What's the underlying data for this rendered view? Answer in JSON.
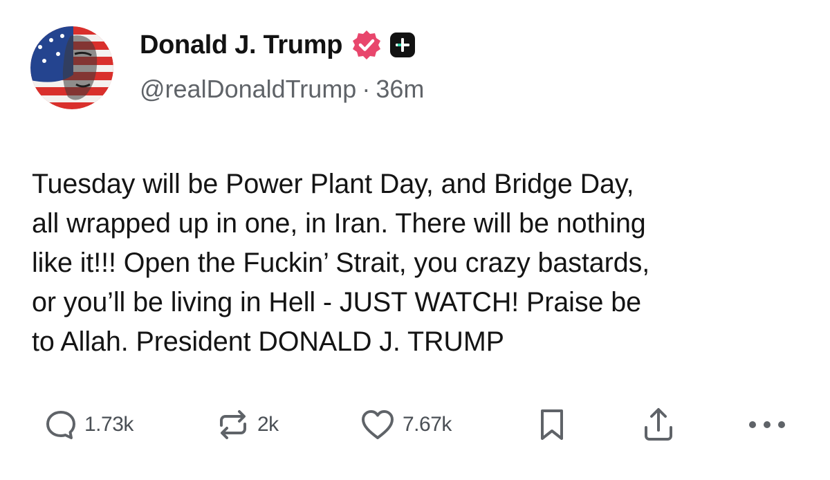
{
  "author": {
    "display_name": "Donald J. Trump",
    "handle": "@realDonaldTrump",
    "separator": "·",
    "time_ago": "36m",
    "badge_color": "#e8466c"
  },
  "post": {
    "text": "Tuesday will be Power Plant Day, and Bridge Day,\nall wrapped up in one, in Iran. There will be nothing\nlike it!!! Open the Fuckin’ Strait, you crazy bastards,\nor you’ll be living in Hell - JUST WATCH! Praise be\nto Allah. President DONALD J. TRUMP"
  },
  "actions": {
    "replies": "1.73k",
    "reposts": "2k",
    "likes": "7.67k"
  },
  "icons": [
    "reply-icon",
    "repost-icon",
    "heart-icon",
    "bookmark-icon",
    "share-icon",
    "more-icon",
    "verified-badge-icon",
    "plus-badge-icon"
  ]
}
